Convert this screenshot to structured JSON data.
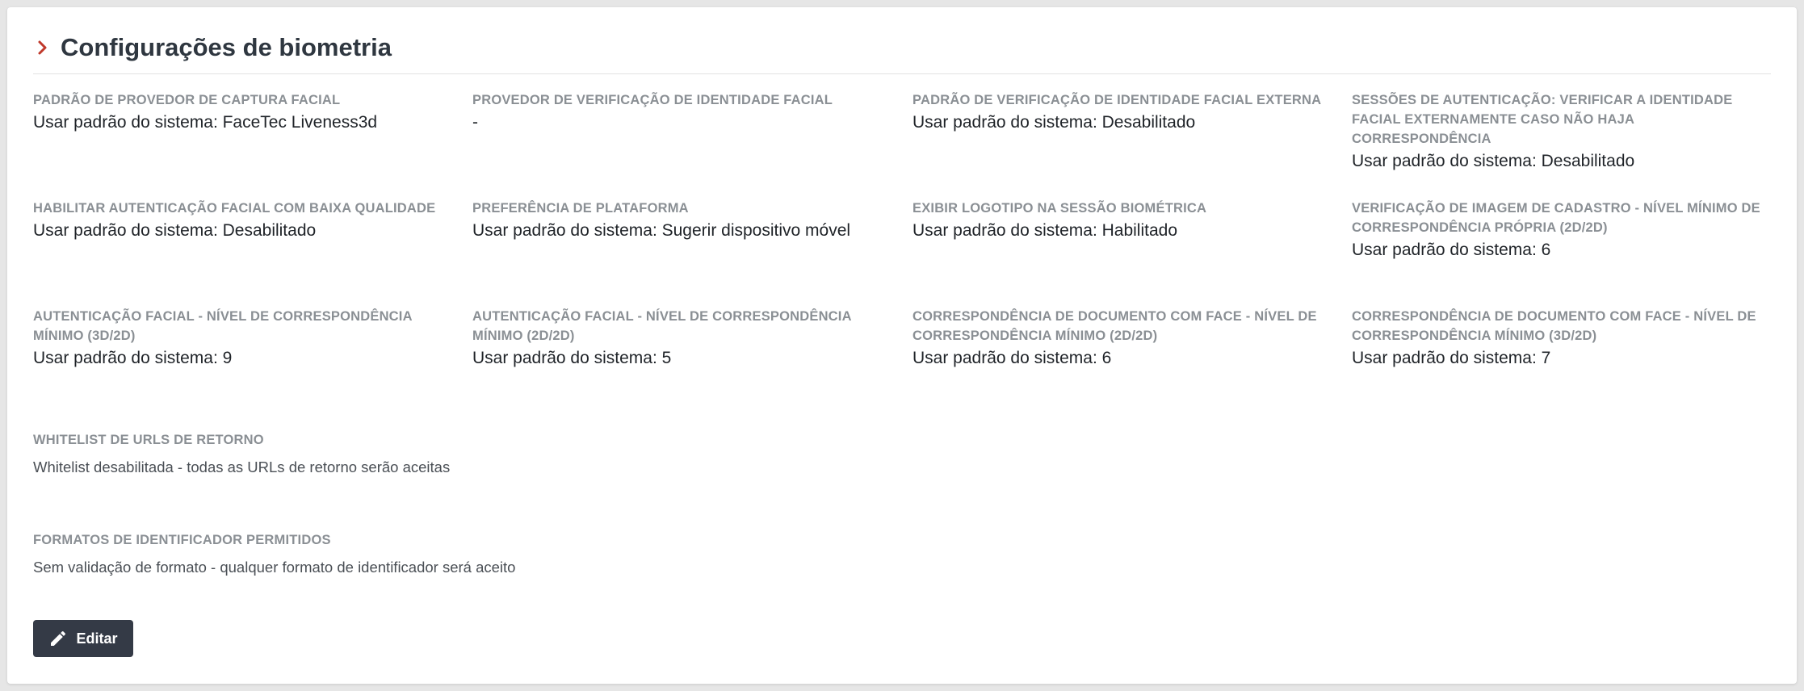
{
  "header": {
    "title": "Configurações de biometria"
  },
  "fields": [
    {
      "label": "Padrão de provedor de captura facial",
      "value": "Usar padrão do sistema: FaceTec Liveness3d"
    },
    {
      "label": "Provedor de verificação de identidade facial",
      "value": "-"
    },
    {
      "label": "Padrão de verificação de identidade facial externa",
      "value": "Usar padrão do sistema: Desabilitado"
    },
    {
      "label": "Sessões de autenticação: Verificar a identidade facial externamente caso não haja correspondência",
      "value": "Usar padrão do sistema: Desabilitado"
    },
    {
      "label": "Habilitar autenticação facial com baixa qualidade",
      "value": "Usar padrão do sistema: Desabilitado"
    },
    {
      "label": "Preferência de plataforma",
      "value": "Usar padrão do sistema: Sugerir dispositivo móvel"
    },
    {
      "label": "Exibir logotipo na sessão biométrica",
      "value": "Usar padrão do sistema: Habilitado"
    },
    {
      "label": "Verificação de imagem de cadastro - Nível mínimo de correspondência própria (2D/2D)",
      "value": "Usar padrão do sistema: 6"
    },
    {
      "label": "Autenticação facial - Nível de correspondência mínimo (3D/2D)",
      "value": "Usar padrão do sistema: 9"
    },
    {
      "label": "Autenticação facial - Nível de correspondência mínimo (2D/2D)",
      "value": "Usar padrão do sistema: 5"
    },
    {
      "label": "Correspondência de documento com face - Nível de correspondência mínimo (2D/2D)",
      "value": "Usar padrão do sistema: 6"
    },
    {
      "label": "Correspondência de documento com face - Nível de correspondência mínimo (3D/2D)",
      "value": "Usar padrão do sistema: 7"
    }
  ],
  "whitelist": {
    "label": "Whitelist de URLs de retorno",
    "value": "Whitelist desabilitada - todas as URLs de retorno serão aceitas"
  },
  "identifier_formats": {
    "label": "Formatos de identificador permitidos",
    "value": "Sem validação de formato - qualquer formato de identificador será aceito"
  },
  "edit_button": {
    "label": "Editar"
  },
  "colors": {
    "accent": "#c0392b",
    "button_bg": "#343a46",
    "title": "#2f3740",
    "label": "#8a8f94"
  },
  "icons": {
    "header": "chevron-right-icon",
    "edit": "pencil-icon"
  }
}
